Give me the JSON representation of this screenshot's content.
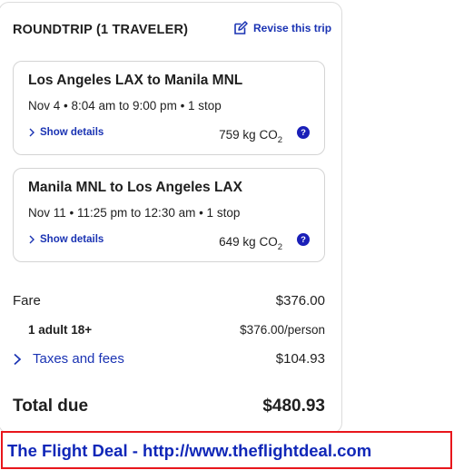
{
  "trip": {
    "title": "ROUNDTRIP (1 TRAVELER)",
    "revise_label": "Revise this trip"
  },
  "flights": [
    {
      "route": "Los Angeles LAX to Manila MNL",
      "schedule": "Nov 4 • 8:04 am to 9:00 pm • 1 stop",
      "details_label": "Show details",
      "co2_value": "759 kg CO",
      "co2_sub": "2"
    },
    {
      "route": "Manila MNL to Los Angeles LAX",
      "schedule": "Nov 11 • 11:25 pm to 12:30 am • 1 stop",
      "details_label": "Show details",
      "co2_value": "649 kg CO",
      "co2_sub": "2"
    }
  ],
  "pricing": {
    "fare_label": "Fare",
    "fare_value": "$376.00",
    "adult_label": "1 adult 18+",
    "adult_value": "$376.00/person",
    "taxes_label": "Taxes and fees",
    "taxes_value": "$104.93",
    "total_label": "Total due",
    "total_value": "$480.93"
  },
  "banner": {
    "text": "The Flight Deal - http://www.theflightdeal.com"
  },
  "colors": {
    "accent": "#1a33b3",
    "help_badge": "#1a1fb8",
    "banner_border": "#e8161c",
    "banner_text": "#1027b8"
  },
  "icons": {
    "revise": "edit-icon",
    "details": "chevron-right-icon",
    "help": "question-icon",
    "taxes": "chevron-right-icon"
  }
}
